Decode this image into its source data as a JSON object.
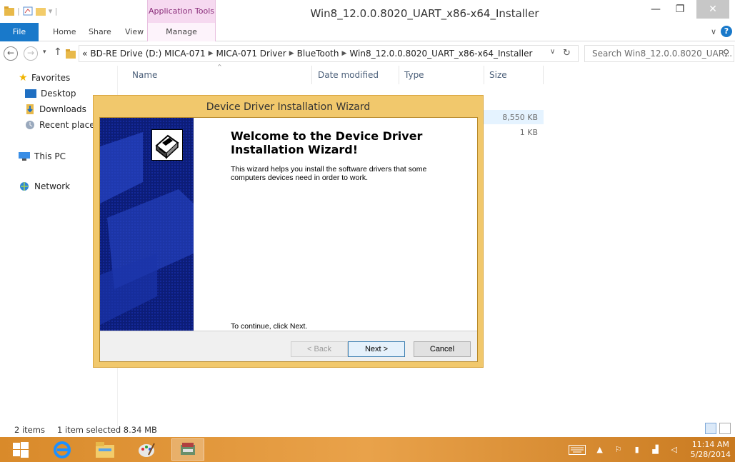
{
  "window": {
    "title": "Win8_12.0.0.8020_UART_x86-x64_Installer",
    "contextual_tab_group": "Application Tools"
  },
  "ribbon": {
    "tabs": [
      "File",
      "Home",
      "Share",
      "View",
      "Manage"
    ]
  },
  "address": {
    "prefix": "«",
    "crumbs": [
      "BD-RE Drive (D:) MICA-071",
      "MICA-071 Driver",
      "BlueTooth",
      "Win8_12.0.0.8020_UART_x86-x64_Installer"
    ],
    "search_placeholder": "Search Win8_12.0.0.8020_UAR..."
  },
  "nav": {
    "favorites": "Favorites",
    "desktop": "Desktop",
    "downloads": "Downloads",
    "recent": "Recent places",
    "thispc": "This PC",
    "network": "Network"
  },
  "columns": {
    "name": "Name",
    "date": "Date modified",
    "type": "Type",
    "size": "Size"
  },
  "files": {
    "sizes": [
      "8,550 KB",
      "1 KB"
    ]
  },
  "wizard": {
    "title": "Device Driver Installation Wizard",
    "heading": "Welcome to the Device Driver Installation Wizard!",
    "description": "This wizard helps you install the software drivers that some computers devices need in order to work.",
    "continue_text": "To continue, click Next.",
    "back": "< Back",
    "next": "Next >",
    "cancel": "Cancel"
  },
  "status": {
    "items": "2 items",
    "selected": "1 item selected  8.34 MB"
  },
  "taskbar": {
    "time": "11:14 AM",
    "date": "5/28/2014"
  },
  "colors": {
    "accent": "#1979ca",
    "wizard_frame": "#f1c86c",
    "wizard_side": "#0c1d78",
    "taskbar": "#e09235"
  }
}
